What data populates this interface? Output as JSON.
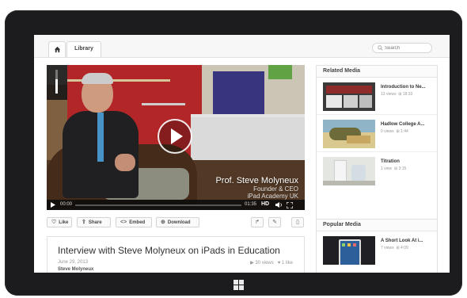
{
  "nav": {
    "tabs": [
      {
        "label": "Library"
      }
    ],
    "search_placeholder": "Search"
  },
  "player": {
    "caption_name": "Prof. Steve Molyneux",
    "caption_line1": "Founder & CEO",
    "caption_line2": "iPad Academy UK",
    "time_elapsed": "00:00",
    "time_total": "01:35",
    "hd_label": "HD",
    "played_fraction": 0
  },
  "actions": {
    "like": "Like",
    "share": "Share",
    "embed": "Embed",
    "download": "Download"
  },
  "video_info": {
    "title": "Interview with Steve Molyneux on iPads in Education",
    "date": "June 29, 2013",
    "author": "Steve Molyneux",
    "views": "30 views",
    "likes": "1 like"
  },
  "related": {
    "heading": "Related Media",
    "items": [
      {
        "title": "Introduction to Ne...",
        "views": "13 views",
        "duration": "18:33"
      },
      {
        "title": "Hadlow College A...",
        "views": "0 views",
        "duration": "1:44"
      },
      {
        "title": "Titration",
        "views": "1 view",
        "duration": "3:15"
      }
    ]
  },
  "popular": {
    "heading": "Popular Media",
    "items": [
      {
        "title": "A Short Look At i...",
        "views": "7 views",
        "duration": "4:09"
      }
    ]
  },
  "colors": {
    "accent_red": "#c22a2c",
    "bezel": "#1c1c1e"
  }
}
